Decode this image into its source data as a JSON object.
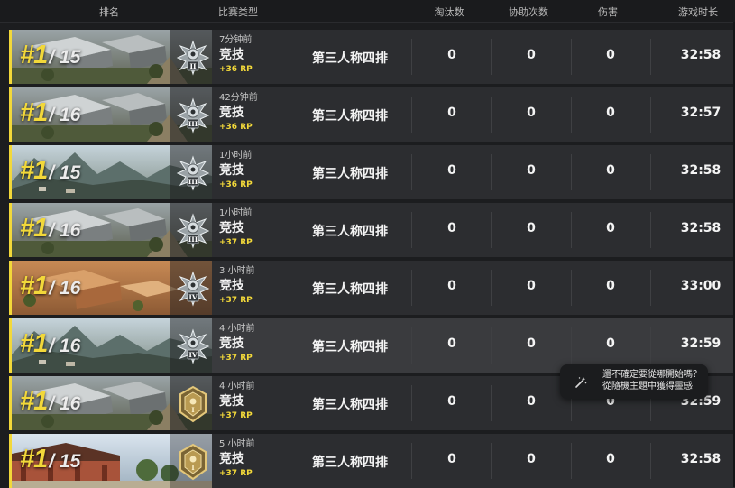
{
  "colors": {
    "accent": "#f2d83a",
    "row_bg": "#2c2d30",
    "row_highlight": "#3a3b3e"
  },
  "header": {
    "rank": "排名",
    "match_type": "比赛类型",
    "kills": "淘汰数",
    "assists": "协助次数",
    "damage": "伤害",
    "duration": "游戏时长"
  },
  "rows": [
    {
      "rank": "#1",
      "total": "/ 15",
      "time": "7分钟前",
      "mode": "竞技",
      "rp": "+36 RP",
      "team": "第三人称四排",
      "kills": "0",
      "assists": "0",
      "damage": "0",
      "duration": "32:58",
      "map": "town",
      "tier": "II",
      "badge": "crystal-tier-badge-icon"
    },
    {
      "rank": "#1",
      "total": "/ 16",
      "time": "42分钟前",
      "mode": "竞技",
      "rp": "+36 RP",
      "team": "第三人称四排",
      "kills": "0",
      "assists": "0",
      "damage": "0",
      "duration": "32:57",
      "map": "town",
      "tier": "III",
      "badge": "crystal-tier-badge-icon"
    },
    {
      "rank": "#1",
      "total": "/ 15",
      "time": "1小时前",
      "mode": "竞技",
      "rp": "+36 RP",
      "team": "第三人称四排",
      "kills": "0",
      "assists": "0",
      "damage": "0",
      "duration": "32:58",
      "map": "mountains",
      "tier": "III",
      "badge": "crystal-tier-badge-icon"
    },
    {
      "rank": "#1",
      "total": "/ 16",
      "time": "1小时前",
      "mode": "竞技",
      "rp": "+37 RP",
      "team": "第三人称四排",
      "kills": "0",
      "assists": "0",
      "damage": "0",
      "duration": "32:58",
      "map": "town",
      "tier": "III",
      "badge": "crystal-tier-badge-icon"
    },
    {
      "rank": "#1",
      "total": "/ 16",
      "time": "3 小时前",
      "mode": "竞技",
      "rp": "+37 RP",
      "team": "第三人称四排",
      "kills": "0",
      "assists": "0",
      "damage": "0",
      "duration": "33:00",
      "map": "desert",
      "tier": "IV",
      "badge": "crystal-tier-badge-icon"
    },
    {
      "rank": "#1",
      "total": "/ 16",
      "time": "4 小时前",
      "mode": "竞技",
      "rp": "+37 RP",
      "team": "第三人称四排",
      "kills": "0",
      "assists": "0",
      "damage": "0",
      "duration": "32:59",
      "map": "mountains",
      "tier": "IV",
      "badge": "crystal-tier-badge-icon"
    },
    {
      "rank": "#1",
      "total": "/ 16",
      "time": "4 小时前",
      "mode": "竞技",
      "rp": "+37 RP",
      "team": "第三人称四排",
      "kills": "0",
      "assists": "0",
      "damage": "0",
      "duration": "32:59",
      "map": "town",
      "tier": "I",
      "badge": "gold-tier-badge-icon"
    },
    {
      "rank": "#1",
      "total": "/ 15",
      "time": "5 小时前",
      "mode": "竞技",
      "rp": "+37 RP",
      "team": "第三人称四排",
      "kills": "0",
      "assists": "0",
      "damage": "0",
      "duration": "32:58",
      "map": "temple",
      "tier": "I",
      "badge": "gold-tier-badge-icon"
    }
  ],
  "tooltip": {
    "line1": "還不確定要從哪開始嗎？",
    "line2": "從隨機主題中獲得靈感",
    "icon": "magic-wand-icon"
  }
}
